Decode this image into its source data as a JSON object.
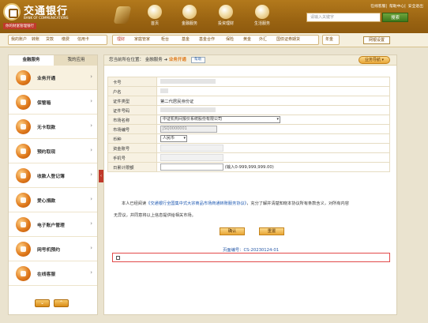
{
  "header": {
    "bank_name_cn": "交通银行",
    "bank_name_en": "BANK OF COMMUNICATIONS",
    "slogan": "你的财富管理银行",
    "nav": [
      {
        "label": "首页",
        "icon": "home-icon"
      },
      {
        "label": "金融服务",
        "icon": "finance-icon"
      },
      {
        "label": "投资理财",
        "icon": "investment-icon"
      },
      {
        "label": "生活服务",
        "icon": "life-icon"
      }
    ],
    "toplinks": [
      "在线客服",
      "帮助中心",
      "安全退出"
    ],
    "search_placeholder": "请输入关键字",
    "search_button": "搜索"
  },
  "subnav": {
    "group1": [
      "我的账户",
      "转账",
      "贷款",
      "缴费",
      "信用卡"
    ],
    "group2": [
      "理财",
      "家庭管家",
      "柜台",
      "基金",
      "基金合作",
      "保险",
      "黄金",
      "外汇",
      "国债证券期货"
    ],
    "group3": [
      "年金"
    ],
    "pref_button": "网银设置"
  },
  "sidebar": {
    "tabs": [
      "金融服务",
      "我的应用"
    ],
    "items": [
      {
        "label": "业务开通",
        "icon": "business-icon",
        "active": true
      },
      {
        "label": "保管箱",
        "icon": "safe-box-icon",
        "active": false
      },
      {
        "label": "无卡取款",
        "icon": "cardless-withdraw-icon",
        "active": false
      },
      {
        "label": "预约取现",
        "icon": "reserve-cash-icon",
        "active": false
      },
      {
        "label": "收款人登记簿",
        "icon": "payee-book-icon",
        "active": false
      },
      {
        "label": "爱心捐款",
        "icon": "donation-icon",
        "active": false
      },
      {
        "label": "电子账户管理",
        "icon": "e-account-icon",
        "active": false
      },
      {
        "label": "网号机预约",
        "icon": "queue-icon",
        "active": false
      },
      {
        "label": "在线客服",
        "icon": "online-service-icon",
        "active": false
      }
    ],
    "pager": {
      "down": "⌄",
      "up": "⌃"
    }
  },
  "main": {
    "crumb_prefix": "您当前所在位置：",
    "crumb_path": "金融服务",
    "crumb_sep": "➜",
    "crumb_current": "业务开通",
    "help_label": "帮助",
    "nav_button": "业务导航 ▾",
    "form": {
      "card_label": "卡号",
      "name_label": "户名",
      "id_type_label": "证件类型",
      "id_type_value": "第二代居民身份证",
      "id_no_label": "证件号码",
      "market_label": "市场名称",
      "market_value": "中证机构间报价系统股份有限公司",
      "market_code_label": "市场编号",
      "market_code_value": "JSQ0000001",
      "currency_label": "币种",
      "currency_value": "人民币",
      "fund_account_label": "资金账号",
      "phone_label": "手机号",
      "limit_label": "日累计限额",
      "limit_hint": "(输入0-999,999,999.00)"
    },
    "agree_prefix": "本人已经阅读",
    "agree_link": "《交通银行全国集中式大宗商品市场商通转账服务协议》",
    "agree_suffix": "，充分了解并清楚知晓本协议所有条款含义，对所有内容",
    "agree_line2": "无异议，并同意将以上信息提供给相关市场。",
    "confirm_button": "确认",
    "reset_button": "重置",
    "page_no": "页面编号：CS-20230124-01"
  }
}
